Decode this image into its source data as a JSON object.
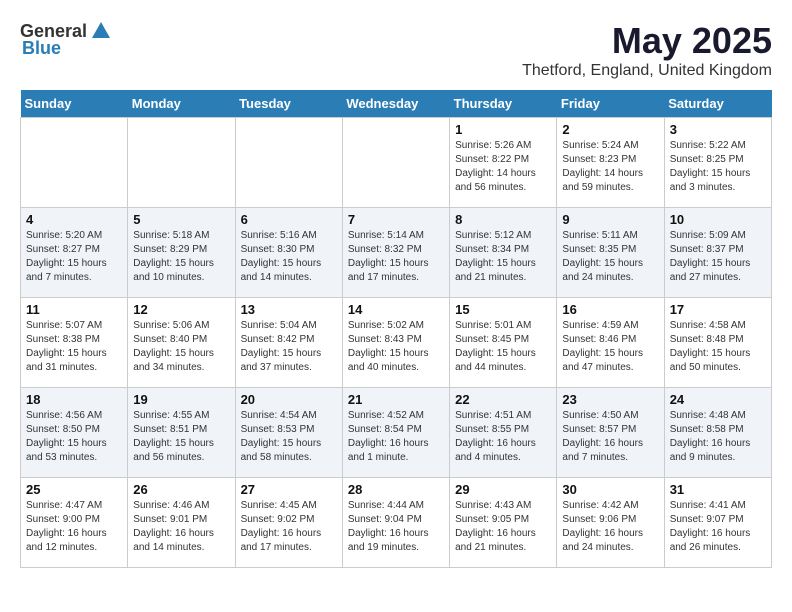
{
  "header": {
    "logo_general": "General",
    "logo_blue": "Blue",
    "month": "May 2025",
    "location": "Thetford, England, United Kingdom"
  },
  "days_of_week": [
    "Sunday",
    "Monday",
    "Tuesday",
    "Wednesday",
    "Thursday",
    "Friday",
    "Saturday"
  ],
  "weeks": [
    [
      {
        "day": "",
        "content": ""
      },
      {
        "day": "",
        "content": ""
      },
      {
        "day": "",
        "content": ""
      },
      {
        "day": "",
        "content": ""
      },
      {
        "day": "1",
        "content": "Sunrise: 5:26 AM\nSunset: 8:22 PM\nDaylight: 14 hours\nand 56 minutes."
      },
      {
        "day": "2",
        "content": "Sunrise: 5:24 AM\nSunset: 8:23 PM\nDaylight: 14 hours\nand 59 minutes."
      },
      {
        "day": "3",
        "content": "Sunrise: 5:22 AM\nSunset: 8:25 PM\nDaylight: 15 hours\nand 3 minutes."
      }
    ],
    [
      {
        "day": "4",
        "content": "Sunrise: 5:20 AM\nSunset: 8:27 PM\nDaylight: 15 hours\nand 7 minutes."
      },
      {
        "day": "5",
        "content": "Sunrise: 5:18 AM\nSunset: 8:29 PM\nDaylight: 15 hours\nand 10 minutes."
      },
      {
        "day": "6",
        "content": "Sunrise: 5:16 AM\nSunset: 8:30 PM\nDaylight: 15 hours\nand 14 minutes."
      },
      {
        "day": "7",
        "content": "Sunrise: 5:14 AM\nSunset: 8:32 PM\nDaylight: 15 hours\nand 17 minutes."
      },
      {
        "day": "8",
        "content": "Sunrise: 5:12 AM\nSunset: 8:34 PM\nDaylight: 15 hours\nand 21 minutes."
      },
      {
        "day": "9",
        "content": "Sunrise: 5:11 AM\nSunset: 8:35 PM\nDaylight: 15 hours\nand 24 minutes."
      },
      {
        "day": "10",
        "content": "Sunrise: 5:09 AM\nSunset: 8:37 PM\nDaylight: 15 hours\nand 27 minutes."
      }
    ],
    [
      {
        "day": "11",
        "content": "Sunrise: 5:07 AM\nSunset: 8:38 PM\nDaylight: 15 hours\nand 31 minutes."
      },
      {
        "day": "12",
        "content": "Sunrise: 5:06 AM\nSunset: 8:40 PM\nDaylight: 15 hours\nand 34 minutes."
      },
      {
        "day": "13",
        "content": "Sunrise: 5:04 AM\nSunset: 8:42 PM\nDaylight: 15 hours\nand 37 minutes."
      },
      {
        "day": "14",
        "content": "Sunrise: 5:02 AM\nSunset: 8:43 PM\nDaylight: 15 hours\nand 40 minutes."
      },
      {
        "day": "15",
        "content": "Sunrise: 5:01 AM\nSunset: 8:45 PM\nDaylight: 15 hours\nand 44 minutes."
      },
      {
        "day": "16",
        "content": "Sunrise: 4:59 AM\nSunset: 8:46 PM\nDaylight: 15 hours\nand 47 minutes."
      },
      {
        "day": "17",
        "content": "Sunrise: 4:58 AM\nSunset: 8:48 PM\nDaylight: 15 hours\nand 50 minutes."
      }
    ],
    [
      {
        "day": "18",
        "content": "Sunrise: 4:56 AM\nSunset: 8:50 PM\nDaylight: 15 hours\nand 53 minutes."
      },
      {
        "day": "19",
        "content": "Sunrise: 4:55 AM\nSunset: 8:51 PM\nDaylight: 15 hours\nand 56 minutes."
      },
      {
        "day": "20",
        "content": "Sunrise: 4:54 AM\nSunset: 8:53 PM\nDaylight: 15 hours\nand 58 minutes."
      },
      {
        "day": "21",
        "content": "Sunrise: 4:52 AM\nSunset: 8:54 PM\nDaylight: 16 hours\nand 1 minute."
      },
      {
        "day": "22",
        "content": "Sunrise: 4:51 AM\nSunset: 8:55 PM\nDaylight: 16 hours\nand 4 minutes."
      },
      {
        "day": "23",
        "content": "Sunrise: 4:50 AM\nSunset: 8:57 PM\nDaylight: 16 hours\nand 7 minutes."
      },
      {
        "day": "24",
        "content": "Sunrise: 4:48 AM\nSunset: 8:58 PM\nDaylight: 16 hours\nand 9 minutes."
      }
    ],
    [
      {
        "day": "25",
        "content": "Sunrise: 4:47 AM\nSunset: 9:00 PM\nDaylight: 16 hours\nand 12 minutes."
      },
      {
        "day": "26",
        "content": "Sunrise: 4:46 AM\nSunset: 9:01 PM\nDaylight: 16 hours\nand 14 minutes."
      },
      {
        "day": "27",
        "content": "Sunrise: 4:45 AM\nSunset: 9:02 PM\nDaylight: 16 hours\nand 17 minutes."
      },
      {
        "day": "28",
        "content": "Sunrise: 4:44 AM\nSunset: 9:04 PM\nDaylight: 16 hours\nand 19 minutes."
      },
      {
        "day": "29",
        "content": "Sunrise: 4:43 AM\nSunset: 9:05 PM\nDaylight: 16 hours\nand 21 minutes."
      },
      {
        "day": "30",
        "content": "Sunrise: 4:42 AM\nSunset: 9:06 PM\nDaylight: 16 hours\nand 24 minutes."
      },
      {
        "day": "31",
        "content": "Sunrise: 4:41 AM\nSunset: 9:07 PM\nDaylight: 16 hours\nand 26 minutes."
      }
    ]
  ]
}
